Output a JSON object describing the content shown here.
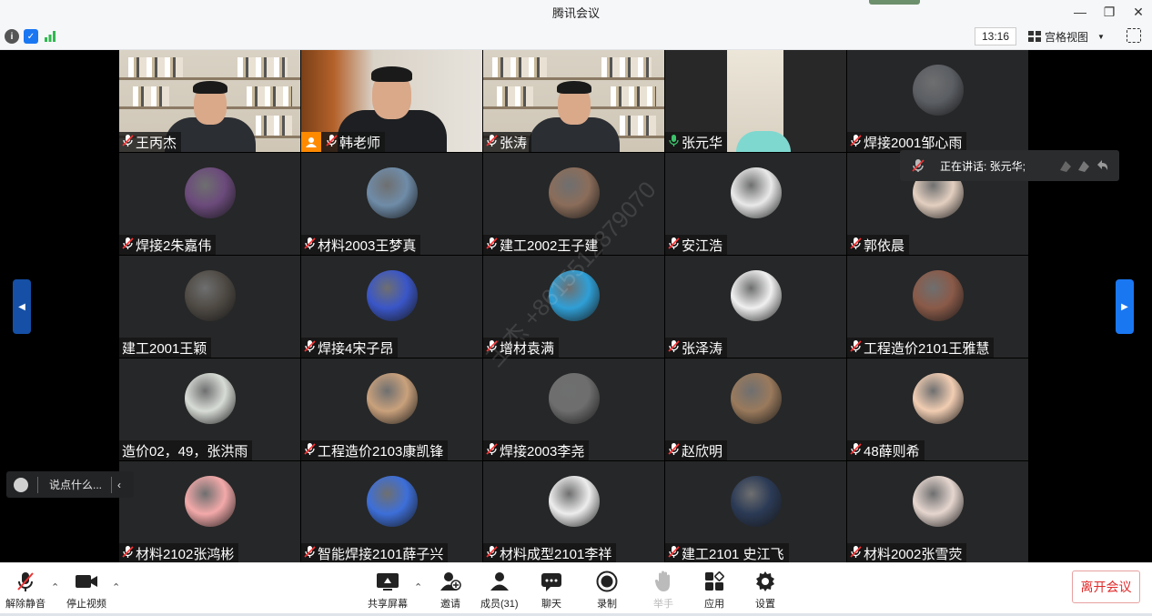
{
  "window": {
    "title": "腾讯会议"
  },
  "infobar": {
    "clock": "13:16",
    "view_mode": "宫格视图"
  },
  "speaking": {
    "text": "正在讲话: 张元华;"
  },
  "chat": {
    "placeholder": "说点什么..."
  },
  "watermark": "王杰 +8615512879070",
  "participants": [
    {
      "name": "王丙杰",
      "kind": "video-shelf"
    },
    {
      "name": "韩老师",
      "kind": "video-office",
      "host": true
    },
    {
      "name": "张涛",
      "kind": "video-shelf"
    },
    {
      "name": "张元华",
      "kind": "video-room",
      "active": true,
      "mic_on": true
    },
    {
      "name": "焊接2001邹心雨",
      "kind": "avatar",
      "color": "#5b5e63"
    },
    {
      "name": "焊接2朱嘉伟",
      "kind": "avatar",
      "color": "#6b4a7b"
    },
    {
      "name": "材料2003王梦真",
      "kind": "avatar",
      "color": "#6f8ca8"
    },
    {
      "name": "建工2002王子建",
      "kind": "avatar",
      "color": "#8b6d5a"
    },
    {
      "name": "安江浩",
      "kind": "avatar",
      "color": "#e9e9e9"
    },
    {
      "name": "郭依晨",
      "kind": "avatar",
      "color": "#e3cfc0"
    },
    {
      "name": "建工2001王颖",
      "kind": "avatar",
      "color": "#4f4a44",
      "no_mic": true
    },
    {
      "name": "焊接4宋子昂",
      "kind": "avatar",
      "color": "#3a56c8"
    },
    {
      "name": "增材袁满",
      "kind": "avatar",
      "color": "#2f9fd6"
    },
    {
      "name": "张泽涛",
      "kind": "avatar",
      "color": "#f0f0f0"
    },
    {
      "name": "工程造价2101王雅慧",
      "kind": "avatar",
      "color": "#8a5a48"
    },
    {
      "name": "造价02，49，张洪雨",
      "kind": "avatar",
      "color": "#d8dcd6",
      "no_mic": true
    },
    {
      "name": "工程造价2103康凯锋",
      "kind": "avatar",
      "color": "#c9a17c"
    },
    {
      "name": "焊接2003李尧",
      "kind": "avatar",
      "color": "#6e6e6e"
    },
    {
      "name": "赵欣明",
      "kind": "avatar",
      "color": "#9a7a5c"
    },
    {
      "name": "48薛则希",
      "kind": "avatar",
      "color": "#f1cdb2"
    },
    {
      "name": "材料2102张鸿彬",
      "kind": "avatar",
      "color": "#f3a9a9"
    },
    {
      "name": "智能焊接2101薛子兴",
      "kind": "avatar",
      "color": "#3d6fd9"
    },
    {
      "name": "材料成型2101李祥",
      "kind": "avatar",
      "color": "#ededed"
    },
    {
      "name": "建工2101  史江飞",
      "kind": "avatar",
      "color": "#2b3a55"
    },
    {
      "name": "材料2002张雪荧",
      "kind": "avatar",
      "color": "#e6d6cf"
    }
  ],
  "toolbar": {
    "unmute": "解除静音",
    "stop_video": "停止视频",
    "share_screen": "共享屏幕",
    "invite": "邀请",
    "members": "成员(31)",
    "chat": "聊天",
    "record": "录制",
    "raise_hand": "举手",
    "apps": "应用",
    "settings": "设置",
    "leave": "离开会议"
  },
  "colors": {
    "leave_red": "#e02b2b",
    "accent_blue": "#1a77f2",
    "host_orange": "#ff8a00",
    "active_green": "#35b36b"
  }
}
